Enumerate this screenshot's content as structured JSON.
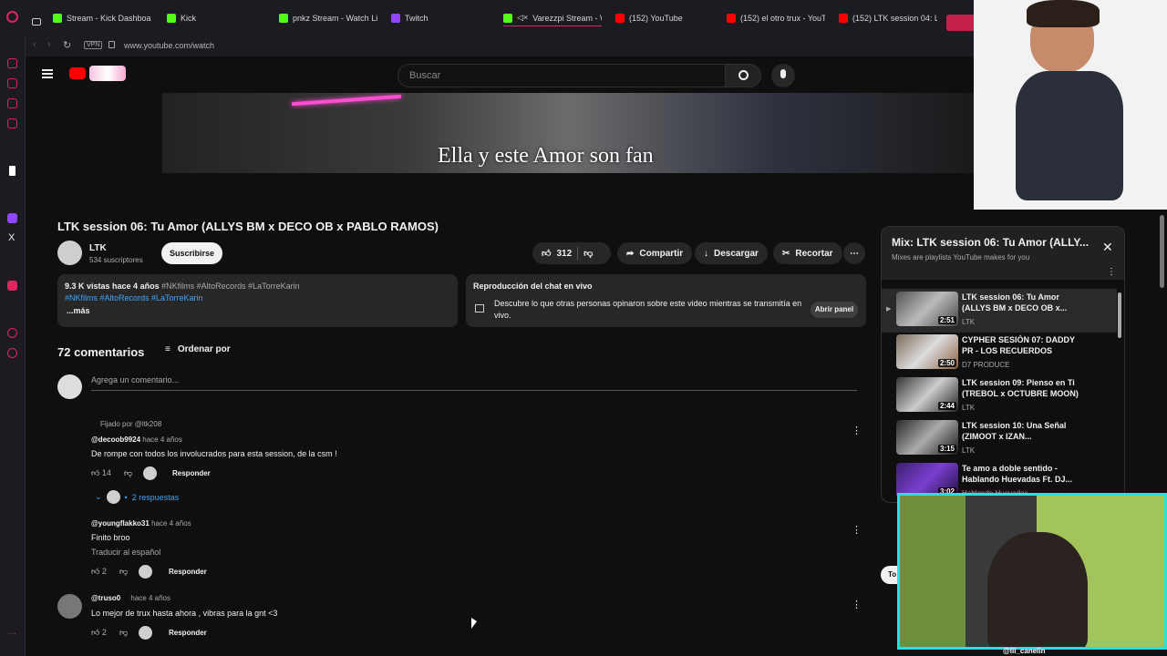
{
  "browser": {
    "tabs": [
      {
        "label": "Stream - Kick Dashboar",
        "color": "#53fc18"
      },
      {
        "label": "Kick",
        "color": "#53fc18"
      },
      {
        "label": "pnkz Stream - Watch Li",
        "color": "#53fc18"
      },
      {
        "label": "Twitch",
        "color": "#9146ff"
      },
      {
        "label": "Varezzpi Stream - W",
        "color": "#53fc18"
      },
      {
        "label": "(152) YouTube",
        "color": "#ff0000"
      },
      {
        "label": "(152) el otro trux - YouT",
        "color": "#ff0000"
      },
      {
        "label": "(152) LTK session 04: L",
        "color": "#ff0000"
      }
    ],
    "vpn": "VPN",
    "url": "www.youtube.com/watch"
  },
  "youtube": {
    "search_placeholder": "Buscar",
    "subtitle": "Ella y este Amor son fan",
    "video_title": "LTK session 06: Tu Amor (ALLYS BM x DECO OB x PABLO RAMOS)",
    "channel": {
      "name": "LTK",
      "subs": "534 suscriptores",
      "subscribe": "Suscribirse"
    },
    "actions": {
      "likes": "312",
      "share": "Compartir",
      "download": "Descargar",
      "clip": "Recortar"
    },
    "description": {
      "stats": "9.3 K vistas",
      "age": "hace 4 años",
      "tags1": "#NKfilms #AltoRecords #LaTorreKarin",
      "tags2": "#NKfilms  #AltoRecords  #LaTorreKarin",
      "more": "...más"
    },
    "chat": {
      "title": "Reproducción del chat en vivo",
      "text": "Descubre lo que otras personas opinaron sobre este video mientras se transmitía en vivo.",
      "button": "Abrir panel"
    },
    "comments": {
      "count": "72 comentarios",
      "sort": "Ordenar por",
      "add_placeholder": "Agrega un comentario...",
      "reply": "Responder",
      "items": [
        {
          "pinned": "Fijado por @ltk208",
          "author": "@decoob9924",
          "age": "hace 4 años",
          "text": "De rompe con todos los involucrados para esta session, de la csm !",
          "likes": "14",
          "replies": "2 respuestas"
        },
        {
          "author": "@youngflakko31",
          "age": "hace 4 años",
          "text": "Finito broo",
          "translate": "Traducir al español",
          "likes": "2"
        },
        {
          "author": "@truso0",
          "age": "hace 4 años",
          "text": "Lo mejor de trux hasta ahora , vibras para la gnt <3",
          "likes": "2"
        }
      ]
    },
    "mix": {
      "title": "Mix: LTK session 06: Tu Amor (ALLY...",
      "subtitle": "Mixes are playlists YouTube makes for you",
      "items": [
        {
          "title": "LTK session 06: Tu Amor (ALLYS BM x DECO OB x...",
          "channel": "LTK",
          "dur": "2:51"
        },
        {
          "title": "CYPHER SESIÓN 07: DADDY PR - LOS RECUERDOS",
          "channel": "D7 PRODUCE",
          "dur": "2:50"
        },
        {
          "title": "LTK session 09: Pienso en Ti (TREBOL x OCTUBRE MOON)",
          "channel": "LTK",
          "dur": "2:44"
        },
        {
          "title": "LTK session 10: Una Señal (ZIMOOT x IZAN...",
          "channel": "LTK",
          "dur": "3:15"
        },
        {
          "title": "Te amo a doble sentido - Hablando Huevadas Ft. DJ...",
          "channel": "Hablando Huevadas",
          "dur": "3:02"
        }
      ]
    },
    "partial_button": "To"
  },
  "webcam": {
    "handle": "@lil_canelin"
  }
}
